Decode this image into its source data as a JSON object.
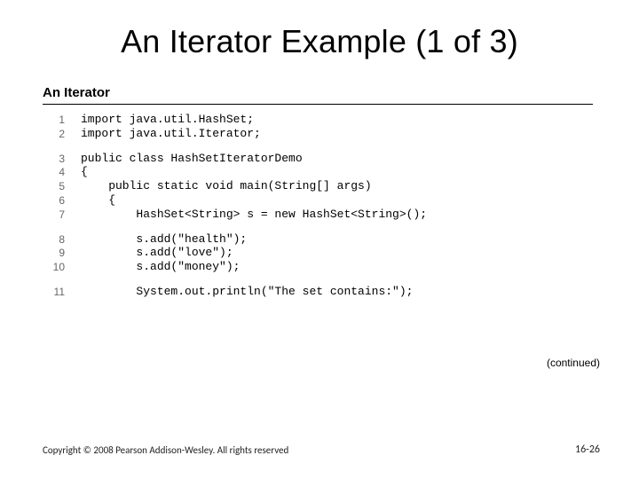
{
  "slide": {
    "title": "An Iterator Example (1 of 3)",
    "display_title": "An Iterator",
    "continued_label": "(continued)"
  },
  "code": {
    "lines": [
      {
        "n": "1",
        "t": "import java.util.HashSet;"
      },
      {
        "n": "2",
        "t": "import java.util.Iterator;"
      },
      {
        "n": "",
        "t": ""
      },
      {
        "n": "3",
        "t": "public class HashSetIteratorDemo"
      },
      {
        "n": "4",
        "t": "{"
      },
      {
        "n": "5",
        "t": "    public static void main(String[] args)"
      },
      {
        "n": "6",
        "t": "    {"
      },
      {
        "n": "7",
        "t": "        HashSet<String> s = new HashSet<String>();"
      },
      {
        "n": "",
        "t": ""
      },
      {
        "n": "8",
        "t": "        s.add(\"health\");"
      },
      {
        "n": "9",
        "t": "        s.add(\"love\");"
      },
      {
        "n": "10",
        "t": "        s.add(\"money\");"
      },
      {
        "n": "",
        "t": ""
      },
      {
        "n": "11",
        "t": "        System.out.println(\"The set contains:\");"
      }
    ]
  },
  "footer": {
    "copyright": "Copyright © 2008 Pearson Addison-Wesley. All rights reserved",
    "page": "16-26"
  }
}
